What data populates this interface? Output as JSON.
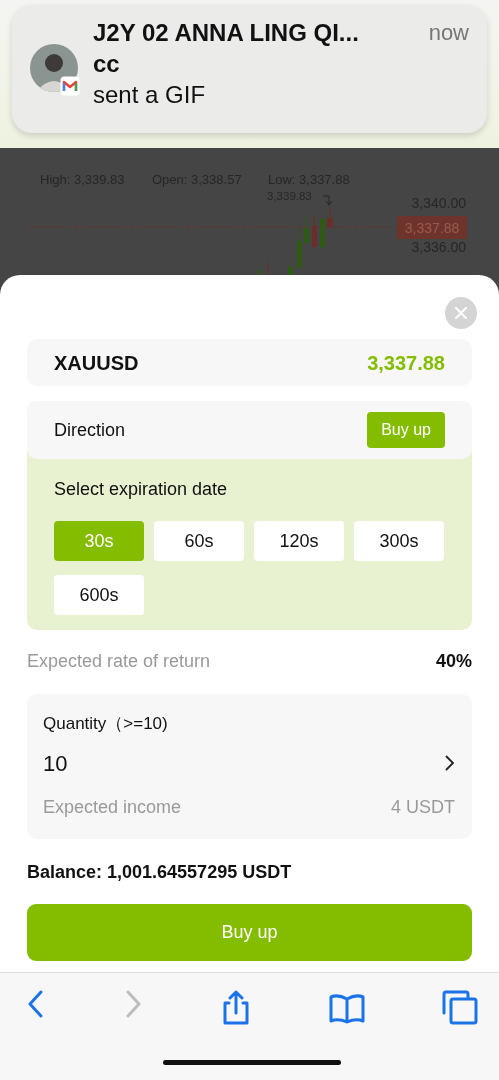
{
  "notification": {
    "sender": "J2Y 02 ANNA LING QI...",
    "time": "now",
    "title": "cc",
    "body": "sent a GIF"
  },
  "chart": {
    "stats": [
      "High: 3,339.83",
      "Open: 3,338.57",
      "Low: 3,337.88"
    ],
    "peak_label": "3,339.83",
    "axis_labels": [
      "3,340.00",
      "3,336.00"
    ],
    "current_price": "3,337.88"
  },
  "sheet": {
    "symbol": "XAUUSD",
    "price": "3,337.88",
    "direction_label": "Direction",
    "direction_button": "Buy up",
    "expiry_label": "Select expiration date",
    "durations": [
      {
        "label": "30s",
        "selected": true
      },
      {
        "label": "60s",
        "selected": false
      },
      {
        "label": "120s",
        "selected": false
      },
      {
        "label": "300s",
        "selected": false
      },
      {
        "label": "600s",
        "selected": false
      }
    ],
    "return_label": "Expected rate of return",
    "return_value": "40%",
    "quantity_label": "Quantity（>=10)",
    "quantity_value": "10",
    "income_label": "Expected income",
    "income_value": "4 USDT",
    "balance": "Balance: 1,001.64557295 USDT",
    "submit": "Buy up"
  },
  "browser_toolbar": [
    {
      "kind": "back",
      "disabled": false
    },
    {
      "kind": "forward",
      "disabled": true
    },
    {
      "kind": "share",
      "disabled": false
    },
    {
      "kind": "bookmarks",
      "disabled": false
    },
    {
      "kind": "tabs",
      "disabled": false
    }
  ]
}
